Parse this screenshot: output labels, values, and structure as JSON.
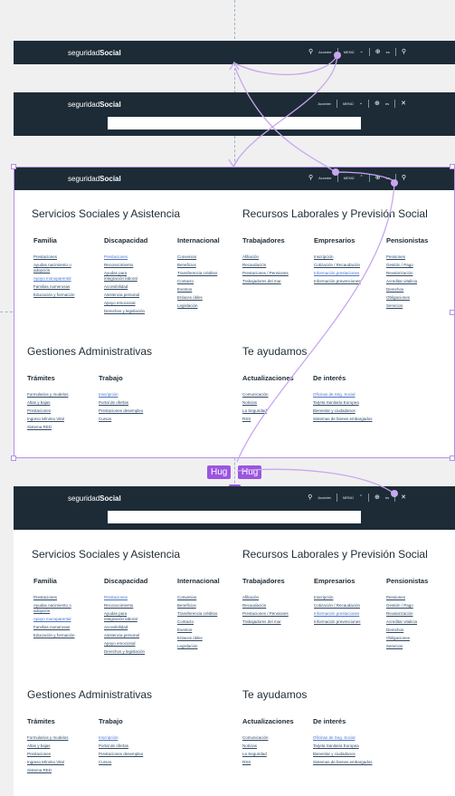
{
  "brand": {
    "light": "seguridad",
    "bold": "Social"
  },
  "nav": {
    "access_label": "Acceder",
    "menu_label": "MENÚ",
    "lang_label": "es",
    "search_icon": "search-icon",
    "close_icon": "close-icon"
  },
  "colors": {
    "nav_bg": "#1c2b36",
    "accent": "#9b55e0",
    "link": "#304a66",
    "link_active": "#4a73c8"
  },
  "menu": {
    "servicios": {
      "title": "Servicios Sociales y Asistencia",
      "columns": [
        {
          "heading": "Familia",
          "items": [
            "Prestaciones",
            "Ayudas nacimiento o adopción",
            "Apoyo monoparental",
            "Familias numerosas",
            "Educación y formación"
          ]
        },
        {
          "heading": "Discapacidad",
          "items": [
            "Prestaciones",
            "Reconocimiento",
            "Ayudas para integración laboral",
            "Accesibilidad",
            "Asistencia personal",
            "Apoyo emocional",
            "Derechos y legislación"
          ]
        },
        {
          "heading": "Internacional",
          "items": [
            "Convenios",
            "Beneficios",
            "Transferencia créditos",
            "Contacto",
            "Eventos",
            "Enlaces útiles",
            "Legislación"
          ]
        }
      ]
    },
    "recursos": {
      "title": "Recursos Laborales y Previsión Social",
      "columns": [
        {
          "heading": "Trabajadores",
          "items": [
            "Afiliación",
            "Recaudación",
            "Prestaciones / Pensiones",
            "Trabajadores del mar"
          ]
        },
        {
          "heading": "Empresarios",
          "items": [
            "Inscripción",
            "Cotización / Recaudación",
            "Información prestaciones",
            "Información prevenciones"
          ]
        },
        {
          "heading": "Pensionistas",
          "items": [
            "Pensiones",
            "Gestión / Pago",
            "Revalorización",
            "Acreditar vitalicia",
            "Derechos",
            "Obligaciones",
            "Servicios"
          ]
        }
      ]
    },
    "gestiones": {
      "title": "Gestiones Administrativas",
      "columns": [
        {
          "heading": "Trámites",
          "items": [
            "Formularios y modelos",
            "Altas y bajas",
            "Prestaciones",
            "Ingreso Mínimo Vital",
            "Sistema RED"
          ]
        },
        {
          "heading": "Trabajo",
          "items": [
            "Inscripción",
            "Portal de ofertas",
            "Prestaciones desempleo",
            "Cursos"
          ]
        }
      ]
    },
    "ayudamos": {
      "title": "Te ayudamos",
      "columns": [
        {
          "heading": "Actualizaciones",
          "items": [
            "Comunicación",
            "Noticias",
            "La Seguridad",
            "RSS"
          ]
        },
        {
          "heading": "De interés",
          "items": [
            "Oficinas de Seg. Social",
            "Tarjeta Sanitaria Europea",
            "Bienestar y ciudadanos",
            "Sistemas de bienes embargados"
          ]
        }
      ]
    }
  },
  "hug_label": "Hug",
  "plus_label": "+"
}
